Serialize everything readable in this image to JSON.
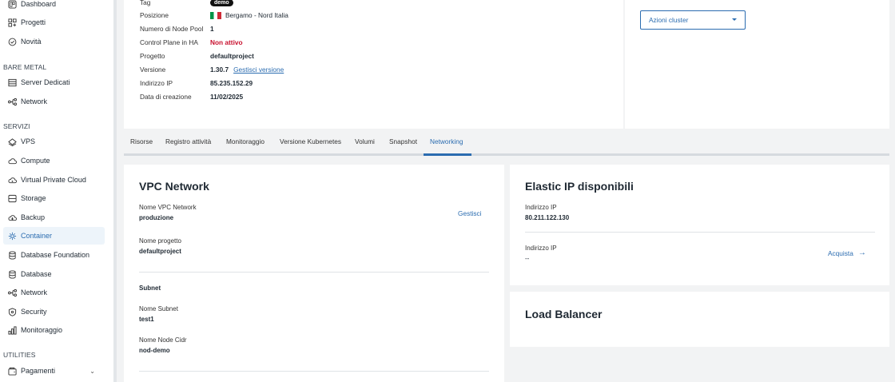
{
  "sidebar": {
    "items_top": [
      {
        "label": "Dashboard",
        "icon": "dashboard-icon"
      },
      {
        "label": "Progetti",
        "icon": "projects-icon"
      },
      {
        "label": "Novità",
        "icon": "news-icon"
      }
    ],
    "section_bare_metal": "BARE METAL",
    "items_bare_metal": [
      {
        "label": "Server Dedicati",
        "icon": "server-icon"
      },
      {
        "label": "Network",
        "icon": "network-icon"
      }
    ],
    "section_servizi": "SERVIZI",
    "items_servizi": [
      {
        "label": "VPS",
        "icon": "vps-icon"
      },
      {
        "label": "Compute",
        "icon": "cloud-icon"
      },
      {
        "label": "Virtual Private Cloud",
        "icon": "vpc-icon"
      },
      {
        "label": "Storage",
        "icon": "storage-icon"
      },
      {
        "label": "Backup",
        "icon": "backup-icon"
      },
      {
        "label": "Container",
        "icon": "container-icon",
        "active": true
      },
      {
        "label": "Database Foundation",
        "icon": "database-icon"
      },
      {
        "label": "Database",
        "icon": "database-icon"
      },
      {
        "label": "Network",
        "icon": "network-icon"
      },
      {
        "label": "Security",
        "icon": "shield-icon"
      },
      {
        "label": "Monitoraggio",
        "icon": "chart-icon"
      }
    ],
    "section_utilities": "UTILITIES",
    "items_utilities": [
      {
        "label": "Pagamenti",
        "icon": "wallet-icon"
      }
    ]
  },
  "cluster_info": {
    "tag_label": "Tag",
    "tag_value": "demo",
    "posizione_label": "Posizione",
    "posizione_value": "Bergamo - Nord Italia",
    "node_pool_label": "Numero di Node Pool",
    "node_pool_value": "1",
    "ha_label": "Control Plane in HA",
    "ha_value": "Non attivo",
    "progetto_label": "Progetto",
    "progetto_value": "defaultproject",
    "versione_label": "Versione",
    "versione_value": "1.30.7",
    "versione_link": "Gestisci versione",
    "ip_label": "Indirizzo IP",
    "ip_value": "85.235.152.29",
    "data_label": "Data di creazione",
    "data_value": "11/02/2025"
  },
  "actions": {
    "cluster_select": "Azioni cluster"
  },
  "tabs": [
    "Risorse",
    "Registro attività",
    "Monitoraggio",
    "Versione Kubernetes",
    "Volumi",
    "Snapshot",
    "Networking"
  ],
  "active_tab": "Networking",
  "vpc": {
    "title": "VPC Network",
    "manage_label": "Gestisci",
    "vpc_name_label": "Nome VPC Network",
    "vpc_name_value": "produzione",
    "project_label": "Nome progetto",
    "project_value": "defaultproject",
    "subnet_heading": "Subnet",
    "subnet_name_label": "Nome Subnet",
    "subnet_name_value": "test1",
    "node_cidr_label": "Nome Node Cidr",
    "node_cidr_value": "nod-demo"
  },
  "elastic_ip": {
    "title": "Elastic IP disponibili",
    "ip1_label": "Indirizzo IP",
    "ip1_value": "80.211.122.130",
    "ip2_label": "Indirizzo IP",
    "ip2_value": "--",
    "buy_label": "Acquista"
  },
  "load_balancer": {
    "title": "Load Balancer"
  },
  "colors": {
    "accent": "#2b6cb0",
    "danger": "#c8102e",
    "background": "#f2f3f4"
  }
}
